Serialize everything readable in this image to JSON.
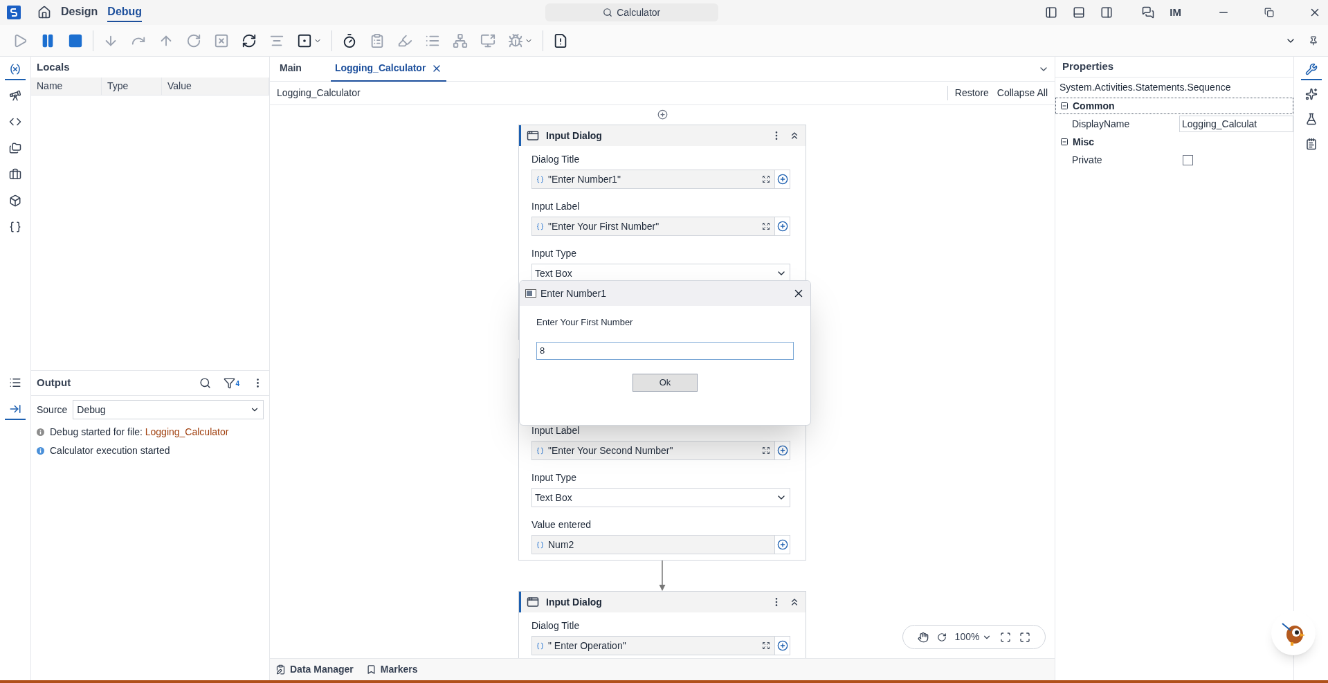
{
  "title_bar": {
    "tabs": [
      {
        "label": "Design",
        "selected": false
      },
      {
        "label": "Debug",
        "selected": true
      }
    ],
    "search": {
      "value": "Calculator"
    },
    "user_initials": "IM"
  },
  "toolbar": {
    "groups": [
      {
        "buttons": [
          {
            "kind": "play",
            "disabled": true,
            "dropdown": false
          },
          {
            "kind": "pause",
            "disabled": false,
            "dropdown": false
          },
          {
            "kind": "stop",
            "disabled": false,
            "dropdown": false
          }
        ]
      },
      {
        "buttons": [
          {
            "kind": "step_into",
            "disabled": true,
            "dropdown": false
          },
          {
            "kind": "step_over",
            "disabled": true,
            "dropdown": false
          },
          {
            "kind": "step_out",
            "disabled": true,
            "dropdown": false
          },
          {
            "kind": "restart",
            "disabled": true,
            "dropdown": false
          },
          {
            "kind": "close",
            "disabled": true,
            "dropdown": false
          },
          {
            "kind": "retry",
            "disabled": false,
            "dropdown": false
          },
          {
            "kind": "focus",
            "disabled": true,
            "dropdown": false
          },
          {
            "kind": "breakpoint",
            "disabled": false,
            "dropdown": true
          }
        ]
      },
      {
        "buttons": [
          {
            "kind": "timer",
            "disabled": false,
            "dropdown": false
          },
          {
            "kind": "clipboard",
            "disabled": true,
            "dropdown": false
          },
          {
            "kind": "highlight",
            "disabled": true,
            "dropdown": false
          },
          {
            "kind": "list",
            "disabled": true,
            "dropdown": false
          },
          {
            "kind": "tree",
            "disabled": true,
            "dropdown": false
          },
          {
            "kind": "screen",
            "disabled": true,
            "dropdown": false
          },
          {
            "kind": "bug",
            "disabled": true,
            "dropdown": true
          }
        ]
      },
      {
        "buttons": [
          {
            "kind": "report",
            "disabled": false,
            "dropdown": false
          }
        ]
      }
    ]
  },
  "left_rail": [
    {
      "kind": "variables",
      "selected": true
    },
    {
      "kind": "telescope",
      "selected": false
    },
    {
      "kind": "code",
      "selected": false
    },
    {
      "kind": "folders",
      "selected": false
    },
    {
      "kind": "toolbox",
      "selected": false
    },
    {
      "kind": "package",
      "selected": false
    },
    {
      "kind": "snippets",
      "selected": false
    }
  ],
  "locals": {
    "title": "Locals",
    "columns": [
      "Name",
      "Type",
      "Value"
    ]
  },
  "output_rail": [
    {
      "kind": "list",
      "selected": false
    },
    {
      "kind": "output",
      "selected": true
    }
  ],
  "output": {
    "title": "Output",
    "filter_count": "4",
    "source_label": "Source",
    "source_value": "Debug",
    "messages": [
      {
        "text": "Debug started for file: ",
        "highlight": "Logging_Calculator",
        "color": "#8c8c8c"
      },
      {
        "text": "Calculator execution started",
        "color": "#4a90d9"
      }
    ]
  },
  "document_tabs": [
    {
      "label": "Main",
      "selected": false,
      "closable": false
    },
    {
      "label": "Logging_Calculator",
      "selected": true,
      "closable": true
    }
  ],
  "breadcrumb": "Logging_Calculator",
  "actions": [
    "Restore",
    "Collapse All"
  ],
  "activities": [
    {
      "title": "Input Dialog",
      "fields": [
        {
          "kind": "expression",
          "label": "Dialog Title",
          "value": "\"Enter Number1\""
        },
        {
          "kind": "expression",
          "label": "Input Label",
          "value": "\"Enter Your First Number\""
        },
        {
          "kind": "select",
          "label": "Input Type",
          "value": "Text Box"
        }
      ]
    },
    {
      "fields": [
        {
          "kind": "expression",
          "label": "Input Label",
          "value": "\"Enter Your Second Number\""
        },
        {
          "kind": "select",
          "label": "Input Type",
          "value": "Text Box"
        },
        {
          "kind": "variable",
          "label": "Value entered",
          "value": "Num2"
        }
      ]
    },
    {
      "title": "Input Dialog",
      "fields": [
        {
          "kind": "expression",
          "label": "Dialog Title",
          "value": "\" Enter Operation\""
        }
      ]
    }
  ],
  "dialog": {
    "title": "Enter Number1",
    "label": "Enter Your First Number",
    "value": "8",
    "button": "Ok"
  },
  "zoom": {
    "value": "100%"
  },
  "bottom_tabs": [
    {
      "kind": "data",
      "label": "Data Manager"
    },
    {
      "kind": "markers",
      "label": "Markers"
    }
  ],
  "properties": {
    "title": "Properties",
    "type_name": "System.Activities.Statements.Sequence",
    "categories": [
      {
        "name": "Common",
        "expanded": true,
        "selected": true,
        "properties": [
          {
            "kind": "text",
            "name": "DisplayName",
            "value": "Logging_Calculat"
          }
        ]
      },
      {
        "name": "Misc",
        "expanded": true,
        "selected": false,
        "properties": [
          {
            "kind": "checkbox",
            "name": "Private",
            "checked": false
          }
        ]
      }
    ]
  },
  "right_rail": [
    {
      "kind": "properties",
      "selected": true
    },
    {
      "kind": "sparkles",
      "selected": false
    },
    {
      "kind": "test",
      "selected": false
    },
    {
      "kind": "outline",
      "selected": false
    }
  ]
}
